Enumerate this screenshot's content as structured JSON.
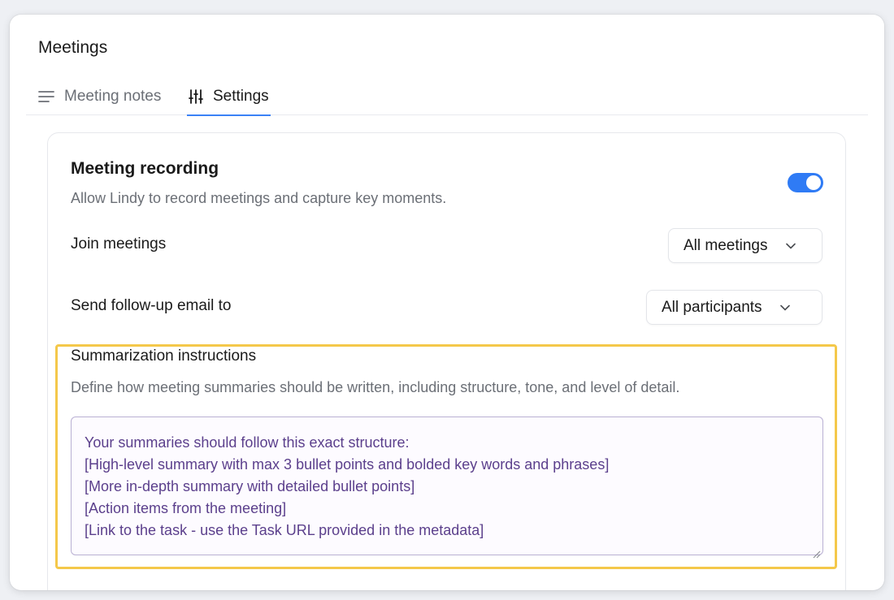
{
  "app": {
    "title": "Meetings"
  },
  "tabs": [
    {
      "label": "Meeting notes",
      "icon": "lines-icon",
      "active": false
    },
    {
      "label": "Settings",
      "icon": "sliders-icon",
      "active": true
    }
  ],
  "recording": {
    "title": "Meeting recording",
    "description": "Allow Lindy to record meetings and capture key moments.",
    "enabled": true
  },
  "join": {
    "label": "Join meetings",
    "value": "All meetings"
  },
  "followup": {
    "label": "Send follow-up email to",
    "value": "All participants"
  },
  "summary": {
    "title": "Summarization instructions",
    "description": "Define how meeting summaries should be written, including structure, tone, and level of detail.",
    "lines": [
      "Your summaries should follow this exact structure:",
      "[High-level summary with max 3 bullet points and bolded key words and phrases]",
      "[More in-depth summary with detailed bullet points]",
      "[Action items from the meeting]",
      "[Link to the task - use the Task URL provided in the metadata]"
    ]
  },
  "colors": {
    "accent": "#3b82f6",
    "toggle": "#2f7bf5",
    "highlight": "#f4c84a",
    "textarea_text": "#5b3f8c"
  }
}
